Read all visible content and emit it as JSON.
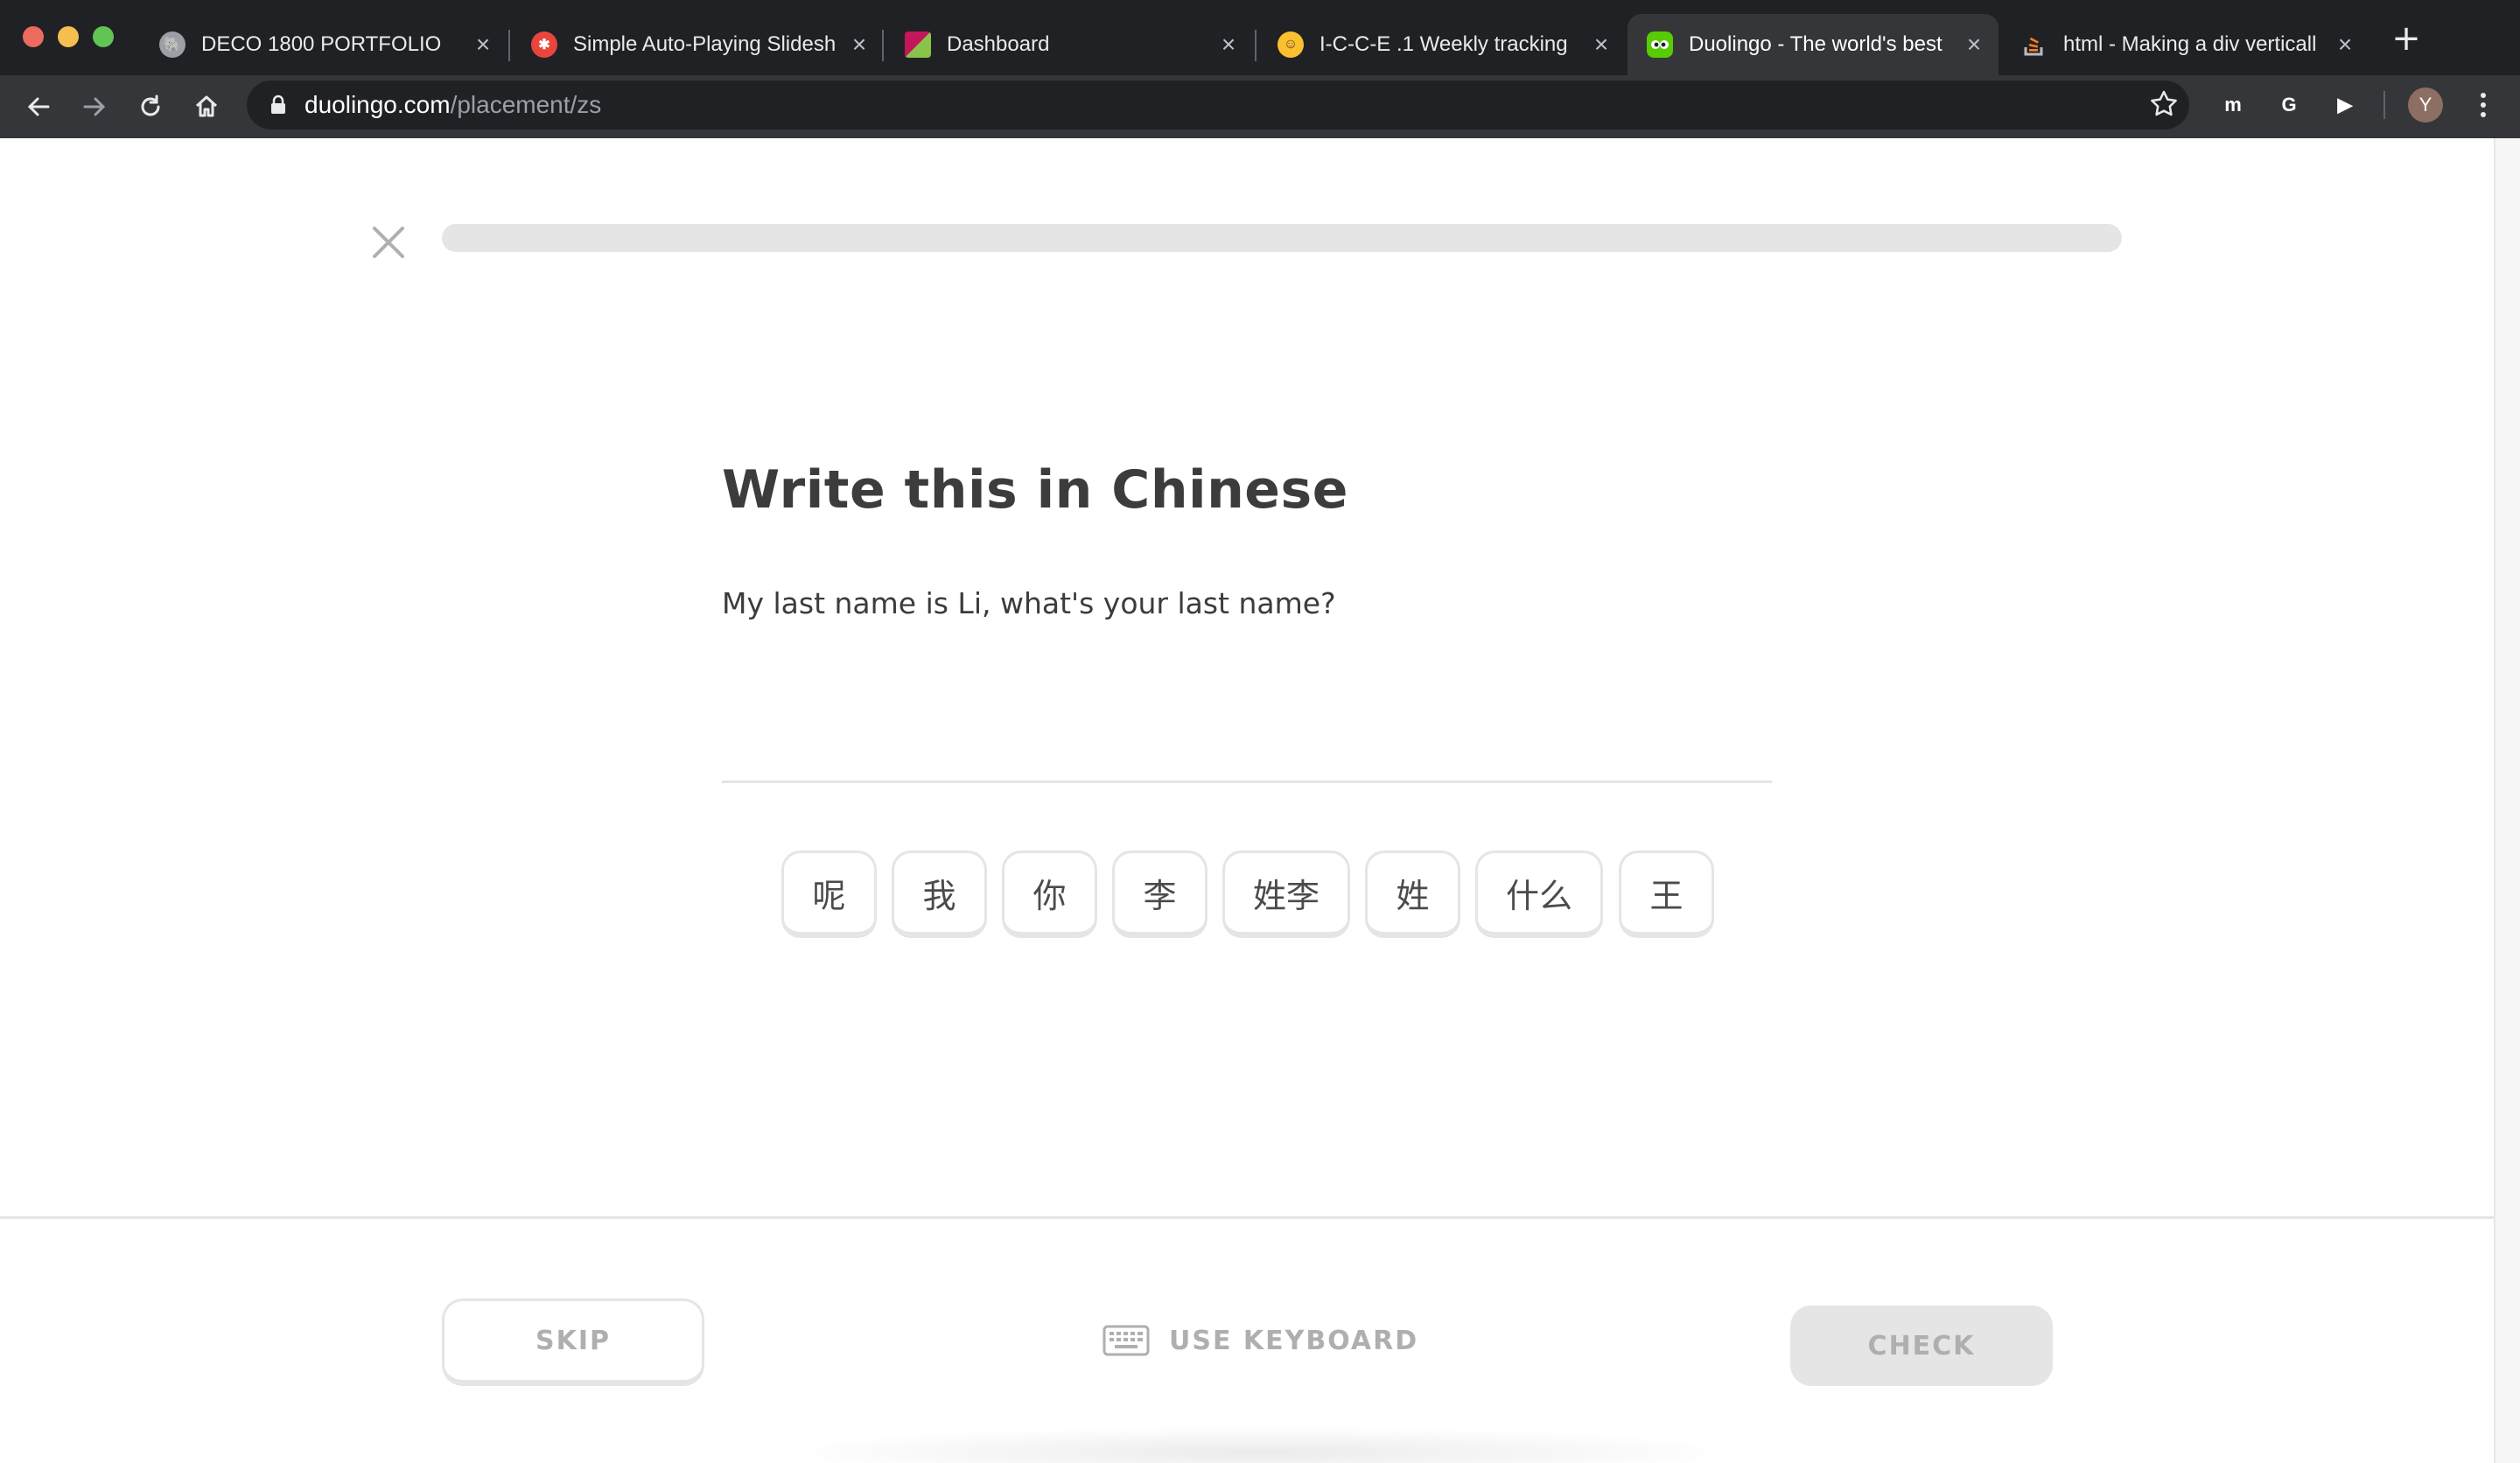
{
  "browser": {
    "tabs": [
      {
        "title": "DECO 1800 PORTFOLIO",
        "icon": "elephant-icon",
        "active": false
      },
      {
        "title": "Simple Auto-Playing Slidesh",
        "icon": "asterisk-logo-icon",
        "active": false
      },
      {
        "title": "Dashboard",
        "icon": "dashboard-logo-icon",
        "active": false
      },
      {
        "title": "I-C-C-E .1 Weekly tracking",
        "icon": "nerd-face-icon",
        "active": false
      },
      {
        "title": "Duolingo - The world's best",
        "icon": "duolingo-owl-icon",
        "active": true
      },
      {
        "title": "html - Making a div verticall",
        "icon": "stackoverflow-icon",
        "active": false
      }
    ],
    "close_glyph": "×",
    "new_tab_glyph": "+",
    "url_host": "duolingo.com",
    "url_path": "/placement/zs",
    "extensions": [
      {
        "name": "teal-extension-icon",
        "label": "m",
        "color": "#26a69a"
      },
      {
        "name": "grammarly-icon",
        "label": "G",
        "color": "#15c39a"
      },
      {
        "name": "red-extension-icon",
        "label": "▶",
        "color": "#d93025"
      }
    ],
    "avatar_initial": "Y"
  },
  "lesson": {
    "progress": 0.0,
    "heading": "Write this in Chinese",
    "prompt": "My last name is Li, what's your last name?",
    "word_bank": [
      "呢",
      "我",
      "你",
      "李",
      "姓李",
      "姓",
      "什么",
      "王"
    ]
  },
  "footer": {
    "skip_label": "SKIP",
    "keyboard_label": "USE KEYBOARD",
    "check_label": "CHECK"
  },
  "colors": {
    "accent": "#58cc02",
    "border": "#e5e5e5",
    "muted_text": "#afafaf",
    "heading_text": "#3c3c3c"
  }
}
